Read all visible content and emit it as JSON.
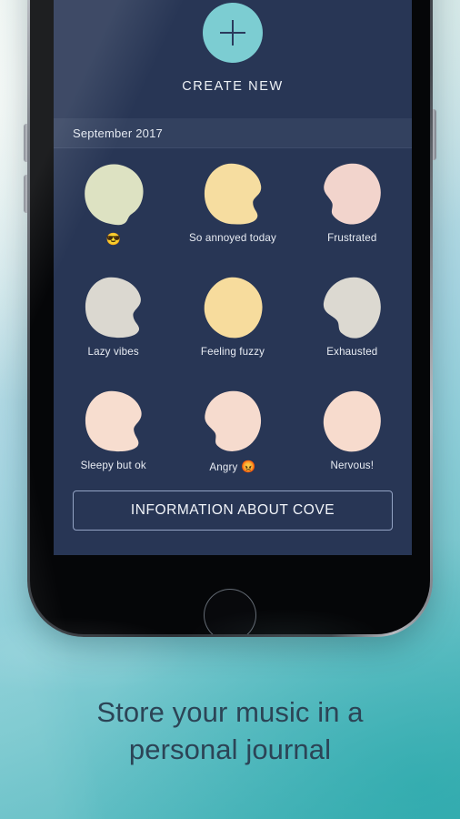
{
  "app": {
    "create": {
      "label": "CREATE NEW",
      "icon": "plus-icon"
    },
    "month_header": "September 2017",
    "info_button": "INFORMATION ABOUT COVE",
    "entries": [
      {
        "label": "",
        "emoji": "😎",
        "color": "#dde2c2",
        "shape": 1
      },
      {
        "label": "So annoyed today",
        "emoji": "",
        "color": "#f6dda0",
        "shape": 2
      },
      {
        "label": "Frustrated",
        "emoji": "",
        "color": "#f2d4cc",
        "shape": 3
      },
      {
        "label": "Lazy vibes",
        "emoji": "",
        "color": "#dbd8d0",
        "shape": 4
      },
      {
        "label": "Feeling fuzzy",
        "emoji": "",
        "color": "#f7dc9d",
        "shape": 5
      },
      {
        "label": "Exhausted",
        "emoji": "",
        "color": "#dcd9d1",
        "shape": 6
      },
      {
        "label": "Sleepy but ok",
        "emoji": "",
        "color": "#f7ddcf",
        "shape": 7
      },
      {
        "label": "Angry",
        "emoji": "😡",
        "color": "#f6dbce",
        "shape": 8
      },
      {
        "label": "Nervous!",
        "emoji": "",
        "color": "#f7dbcd",
        "shape": 9
      }
    ]
  },
  "caption": {
    "line1": "Store your music in a",
    "line2": "personal journal"
  },
  "colors": {
    "app_background": "#283655",
    "month_bar": "#33415f",
    "accent_teal": "#7ccdd2",
    "caption_text": "#2c4456"
  }
}
